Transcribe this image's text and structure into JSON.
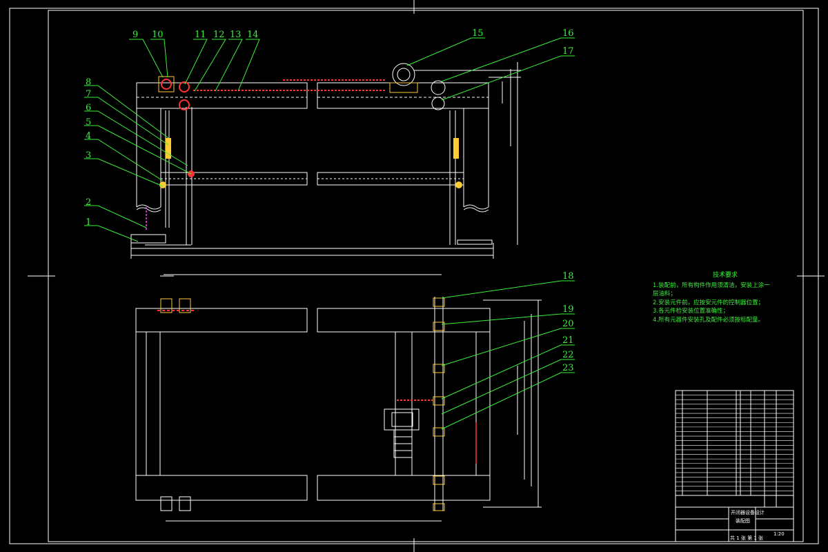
{
  "drawing": {
    "part_balloons": [
      "1",
      "2",
      "3",
      "4",
      "5",
      "6",
      "7",
      "8",
      "9",
      "10",
      "11",
      "12",
      "13",
      "14",
      "15",
      "16",
      "17",
      "18",
      "19",
      "20",
      "21",
      "22",
      "23"
    ],
    "technical_notes": {
      "title": "技术要求",
      "lines": [
        "1.装配前，所有构件作用须清洁，安装上涂一",
        "层油料；",
        "2.安装元件前，应按安元件的控制器位置；",
        "3.各元件检安装位置准确性；",
        "4.所有元器件安装孔及配件必须按标配量。"
      ]
    },
    "title_block": {
      "project_title": "开闭器设备设计",
      "drawing_name": "装配图",
      "scale": "1:20",
      "sheet_info": "共 1 张  第 1 张"
    }
  },
  "colors": {
    "background": "#000000",
    "line": "#ffffff",
    "leader": "#3cf03c",
    "part_red": "#ff3333",
    "part_yellow": "#ffcc33",
    "part_magenta": "#ff44ff"
  }
}
